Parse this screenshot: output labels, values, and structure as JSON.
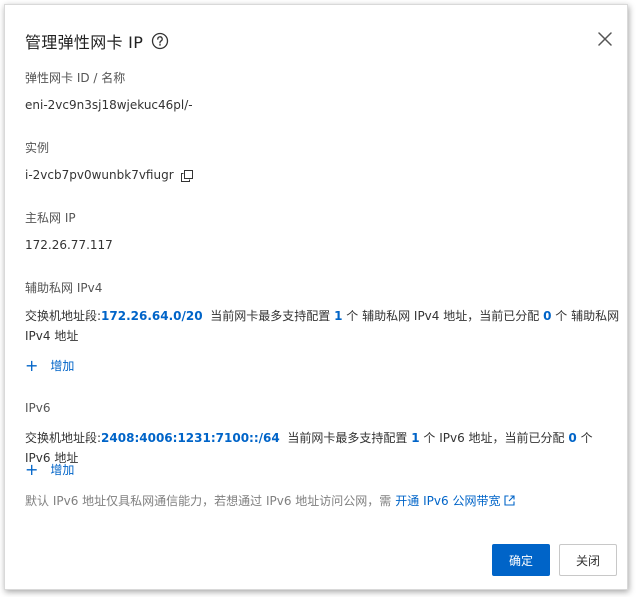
{
  "dialog": {
    "title": "管理弹性网卡 IP",
    "eni_label": "弹性网卡 ID / 名称",
    "eni_value": "eni-2vc9n3sj18wjekuc46pl/-",
    "instance_label": "实例",
    "instance_value": "i-2vcb7pv0wunbk7vfiugr",
    "primary_ip_label": "主私网 IP",
    "primary_ip_value": "172.26.77.117",
    "secondary_ipv4": {
      "label": "辅助私网 IPv4",
      "prefix": "交换机地址段:",
      "cidr": "172.26.64.0/20",
      "text1": "当前网卡最多支持配置",
      "max": "1",
      "text2": "个 辅助私网 IPv4 地址，当前已分配",
      "assigned": "0",
      "text3": "个 辅助私网 IPv4 地址",
      "add_label": "增加"
    },
    "ipv6": {
      "label": "IPv6",
      "prefix": "交换机地址段:",
      "cidr": "2408:4006:1231:7100::/64",
      "text1": "当前网卡最多支持配置",
      "max": "1",
      "text2": "个 IPv6 地址，当前已分配",
      "assigned": "0",
      "text3": "个 IPv6 地址",
      "add_label": "增加"
    },
    "note_text": "默认 IPv6 地址仅具私网通信能力，若想通过 IPv6 地址访问公网，需",
    "note_link": "开通 IPv6 公网带宽",
    "confirm_label": "确定",
    "close_label": "关闭"
  },
  "colors": {
    "accent": "#0064c8",
    "muted": "#808080"
  },
  "icons": [
    "help-icon",
    "close-icon",
    "copy-icon",
    "plus-icon",
    "external-link-icon"
  ]
}
